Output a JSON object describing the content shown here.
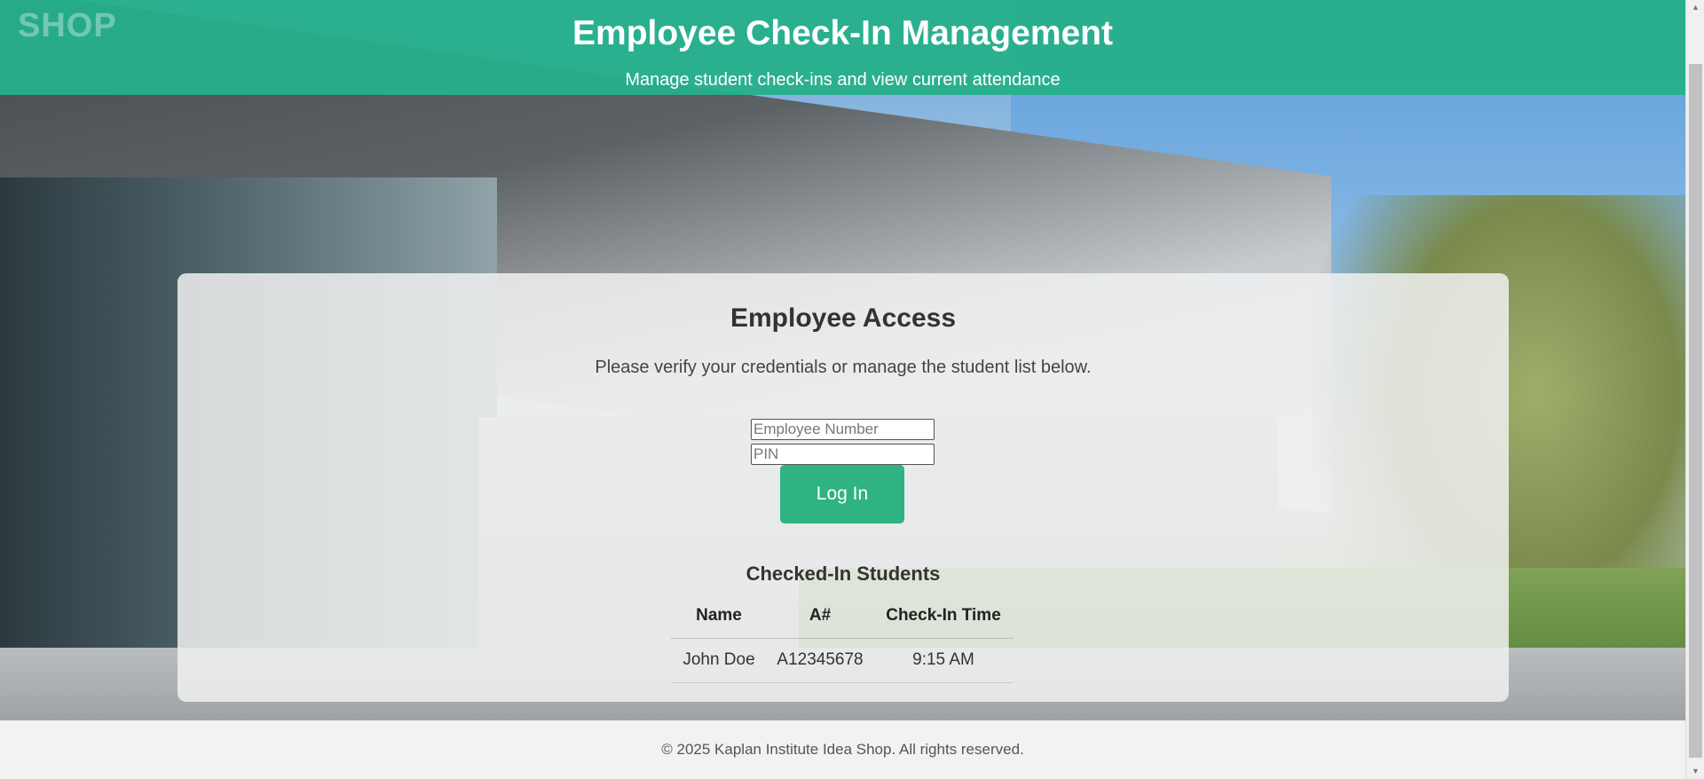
{
  "header": {
    "logo_text": "SHOP",
    "title": "Employee Check-In Management",
    "subtitle": "Manage student check-ins and view current attendance"
  },
  "access_card": {
    "title": "Employee Access",
    "instructions": "Please verify your credentials or manage the student list below.",
    "employee_number": {
      "value": "",
      "placeholder": "Employee Number"
    },
    "pin": {
      "value": "",
      "placeholder": "PIN"
    },
    "login_label": "Log In"
  },
  "students": {
    "title": "Checked-In Students",
    "columns": [
      "Name",
      "A#",
      "Check-In Time"
    ],
    "rows": [
      {
        "name": "John Doe",
        "anum": "A12345678",
        "time": "9:15 AM"
      }
    ]
  },
  "footer": {
    "text": "© 2025 Kaplan Institute Idea Shop. All rights reserved."
  },
  "colors": {
    "header_bg": "#26b08a",
    "button_bg": "#2fb383"
  }
}
